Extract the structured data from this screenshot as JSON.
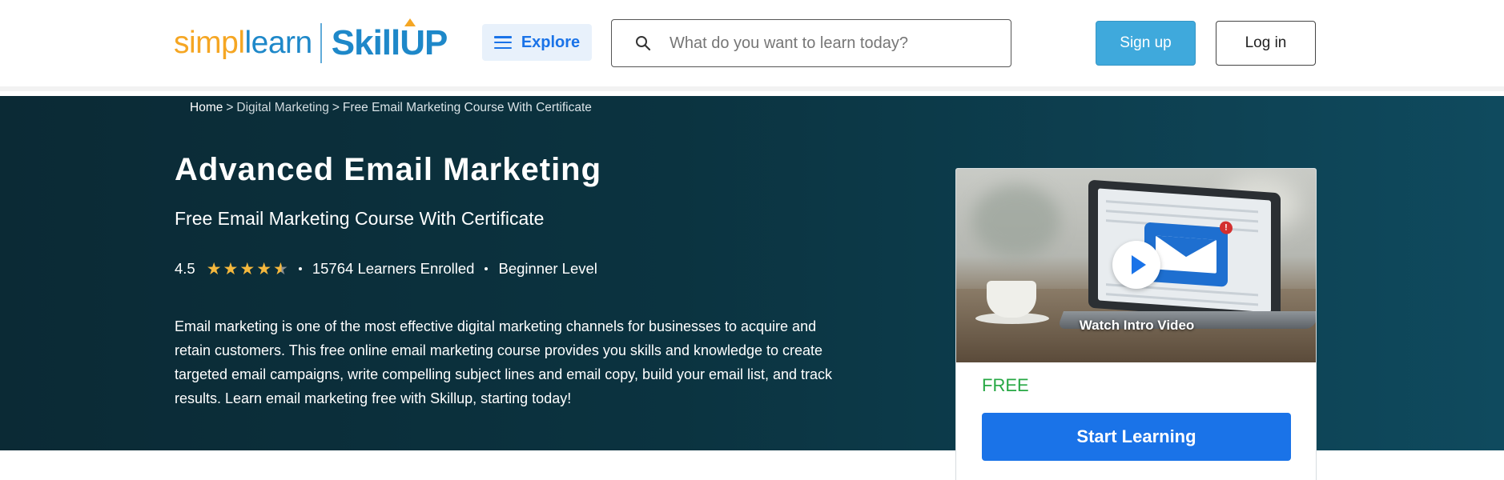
{
  "brand": {
    "logo_part1": "simpl",
    "logo_part2": "learn",
    "logo_part3": "Skill",
    "logo_part4": "UP"
  },
  "header": {
    "explore_label": "Explore",
    "search_placeholder": "What do you want to learn today?",
    "signup_label": "Sign up",
    "login_label": "Log in"
  },
  "breadcrumb": {
    "home": "Home",
    "sep1": ">",
    "category": "Digital Marketing",
    "sep2": ">",
    "current": "Free Email Marketing Course With Certificate"
  },
  "course": {
    "title": "Advanced Email Marketing",
    "subtitle": "Free Email Marketing Course With Certificate",
    "rating": "4.5",
    "rating_value": 4.5,
    "rating_max": 5,
    "learners": "15764 Learners Enrolled",
    "level": "Beginner Level",
    "description": "Email marketing is one of the most effective digital marketing channels for businesses to acquire and retain customers. This free online email marketing course provides you skills and knowledge to create targeted email campaigns, write compelling subject lines and email copy, build your email list, and track results. Learn email marketing free with Skillup, starting today!"
  },
  "card": {
    "video_label": "Watch Intro Video",
    "price": "FREE",
    "cta_label": "Start Learning",
    "badge": "!"
  },
  "icons": {
    "search": "search-icon",
    "menu": "hamburger-icon",
    "play": "play-icon",
    "star": "star-icon"
  },
  "colors": {
    "primary_blue": "#1a73e8",
    "signup_blue": "#3fa9dc",
    "hero_bg": "#0b3340",
    "star": "#f5b83d",
    "free_green": "#27a844",
    "logo_orange": "#f5a623",
    "logo_blue": "#1e88c9"
  }
}
